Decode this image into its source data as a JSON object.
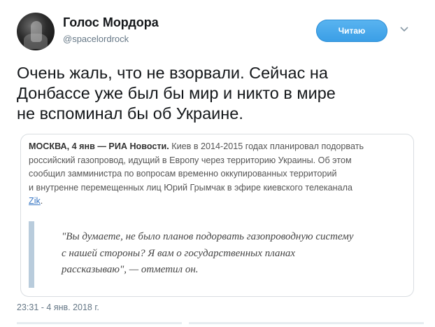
{
  "author": {
    "display_name": "Голос Мордора",
    "handle": "@spacelordrock",
    "follow_label": "Читаю"
  },
  "tweet": {
    "lines": [
      "Очень жаль, что не взорвали. Сейчас на",
      "Донбассе уже был бы мир и никто в мире",
      "не вспоминал бы об Украине."
    ]
  },
  "card": {
    "dateline": "МОСКВА, 4 янв — РИА Новости.",
    "line1_rest": " Киев в 2014-2015 годах планировал подорвать",
    "lines": [
      "российский газопровод, идущий в Европу через территорию Украины. Об этом",
      "сообщил замминистра по вопросам временно оккупированных территорий",
      "и внутренне перемещенных лиц Юрий Грымчак в эфире киевского телеканала"
    ],
    "link_text": "Zik",
    "link_suffix": ".",
    "quote_lines": [
      "\"Вы думаете, не было планов подорвать газопроводную систему",
      "с нашей стороны? Я вам о государственных планах",
      "рассказываю\", — отметил он."
    ]
  },
  "timestamp": "23:31 - 4 янв. 2018 г.",
  "icons": {
    "menu": "chevron-down-icon"
  },
  "colors": {
    "follow_button": "#3a9ee6",
    "quote_bar": "#b9ccdc",
    "link": "#3a78c4"
  }
}
